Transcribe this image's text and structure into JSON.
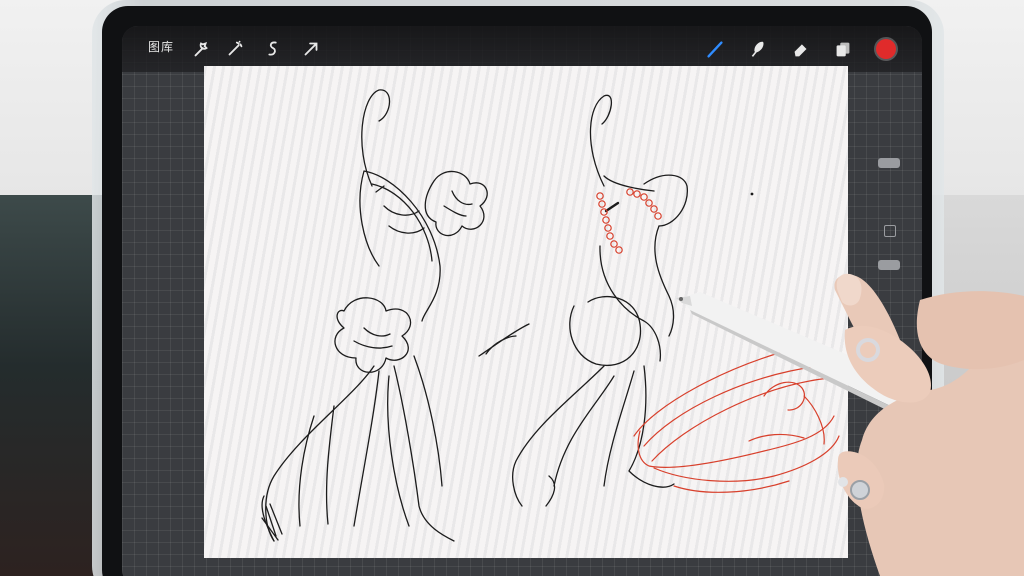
{
  "toolbar": {
    "gallery_label": "图库",
    "icons": [
      "wrench-icon",
      "adjustments-icon",
      "selection-icon",
      "transform-icon",
      "brush-icon",
      "smudge-icon",
      "eraser-icon",
      "layers-icon"
    ],
    "active_color": "#e02b2b",
    "active_tool_color": "#2f8cff"
  },
  "colors": {
    "ink_black": "#1c1c1c",
    "ink_red": "#d8402c"
  }
}
